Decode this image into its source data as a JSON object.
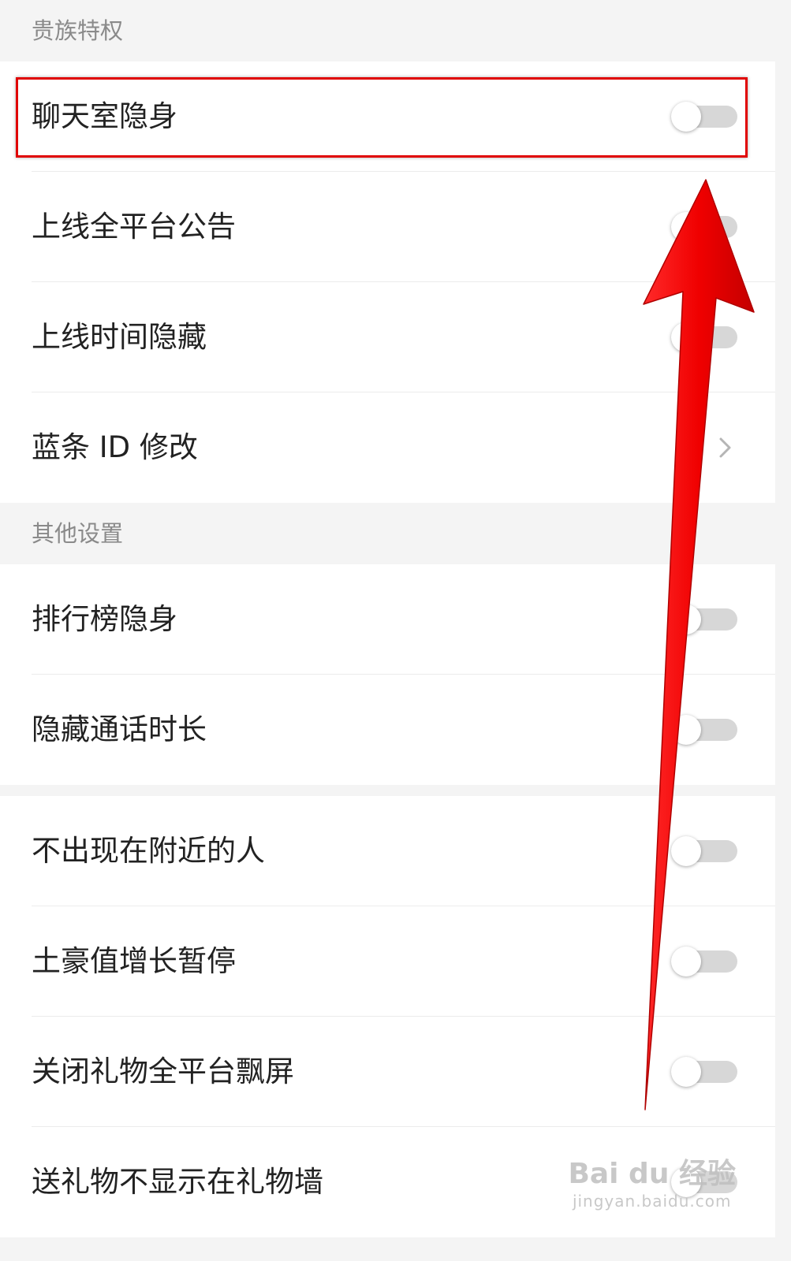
{
  "sections": [
    {
      "header": "贵族特权",
      "items": [
        {
          "label": "聊天室隐身",
          "control": "toggle",
          "on": false
        },
        {
          "label": "上线全平台公告",
          "control": "toggle",
          "on": false
        },
        {
          "label": "上线时间隐藏",
          "control": "toggle",
          "on": false
        },
        {
          "label": "蓝条 ID 修改",
          "control": "chevron"
        }
      ]
    },
    {
      "header": "其他设置",
      "items": [
        {
          "label": "排行榜隐身",
          "control": "toggle",
          "on": false
        },
        {
          "label": "隐藏通话时长",
          "control": "toggle",
          "on": false
        }
      ]
    },
    {
      "header": "",
      "items": [
        {
          "label": "不出现在附近的人",
          "control": "toggle",
          "on": false
        },
        {
          "label": "土豪值增长暂停",
          "control": "toggle",
          "on": false
        },
        {
          "label": "关闭礼物全平台飘屏",
          "control": "toggle",
          "on": false
        },
        {
          "label": "送礼物不显示在礼物墙",
          "control": "toggle",
          "on": false
        }
      ]
    }
  ],
  "watermark": {
    "brand": "Bai du 经验",
    "url": "jingyan.baidu.com"
  },
  "colors": {
    "annotation": "#e00000",
    "toggle_off_track": "#d7d7d7"
  },
  "icons": {
    "chevron": "chevron-right-icon"
  }
}
